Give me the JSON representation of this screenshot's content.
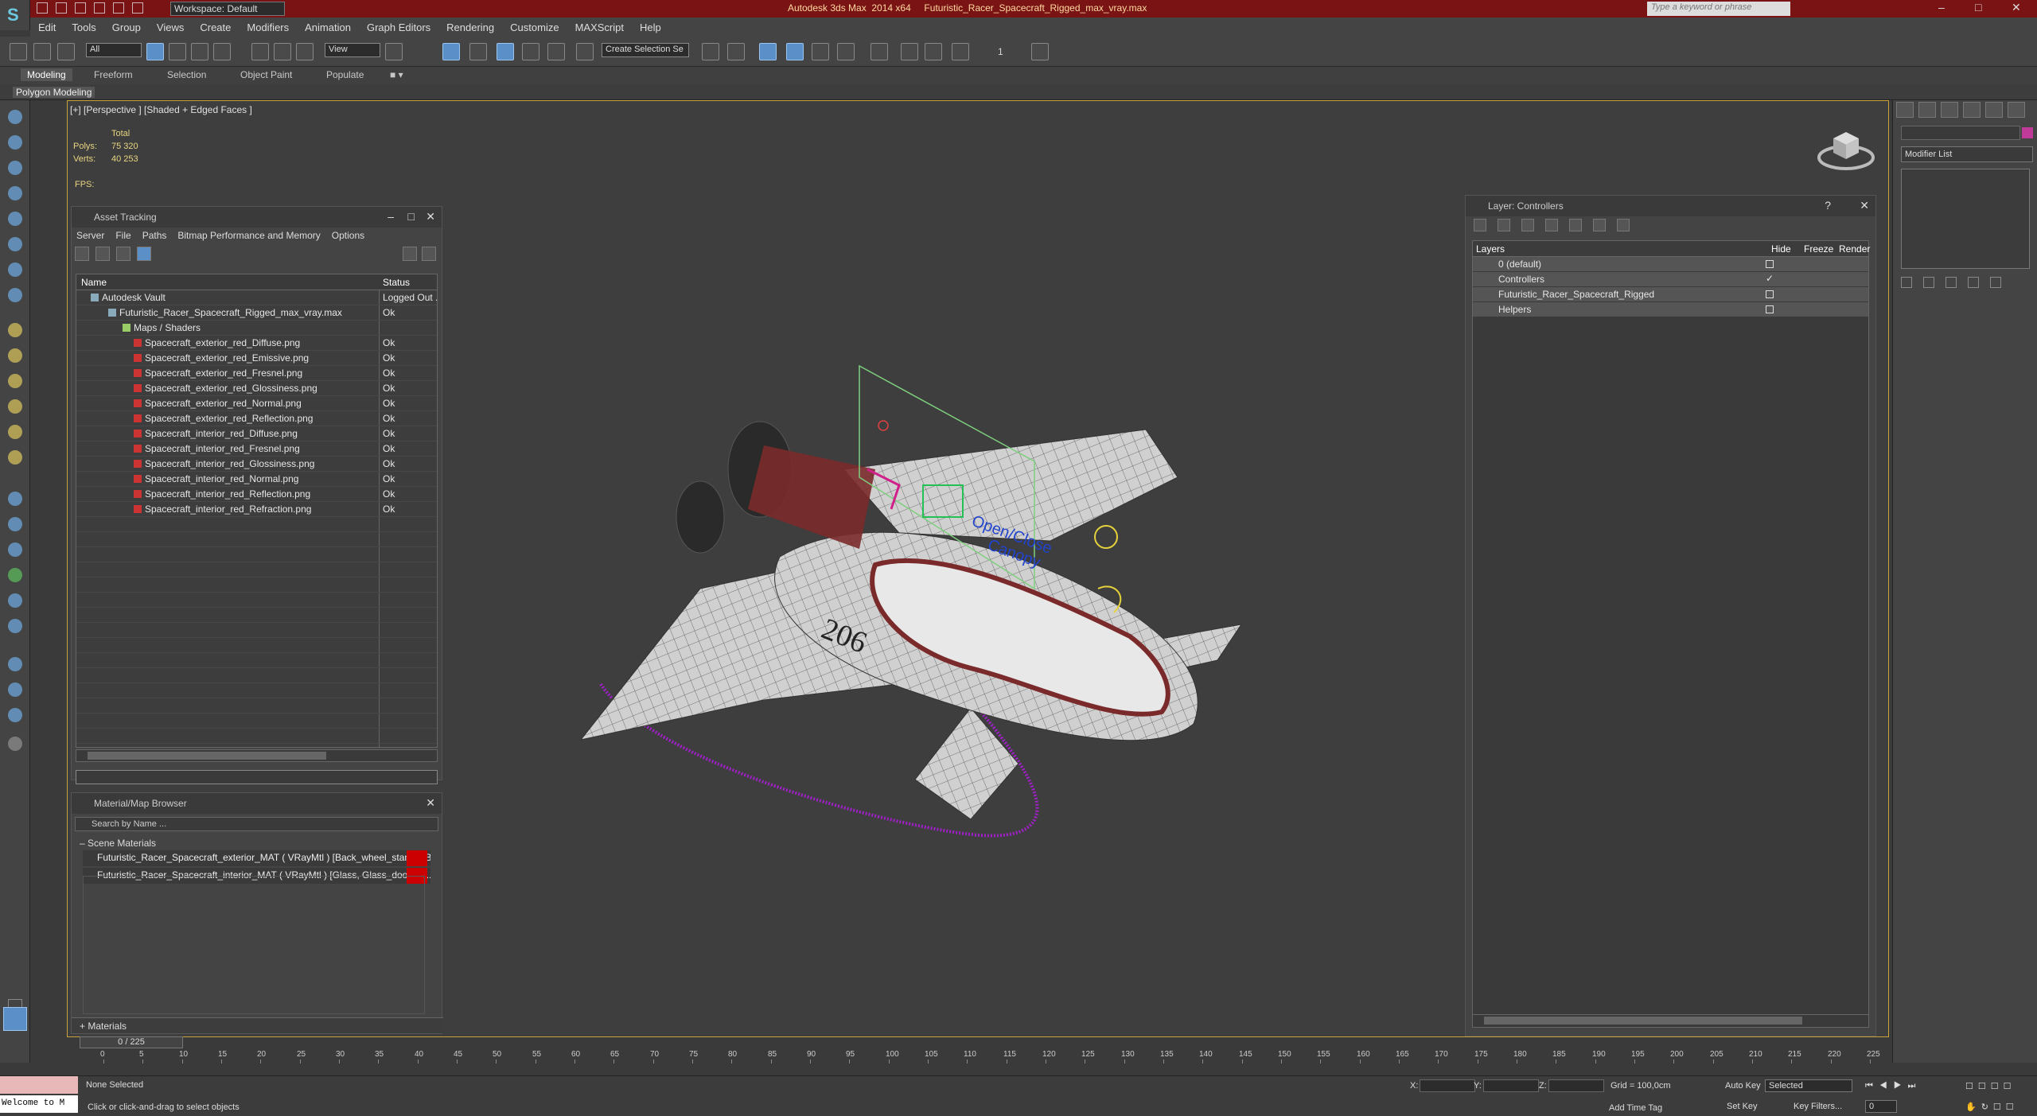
{
  "titlebar": {
    "title": "Autodesk 3ds Max  2014 x64     Futuristic_Racer_Spacecraft_Rigged_max_vray.max",
    "workspace": "Workspace: Default",
    "search_placeholder": "Type a keyword or phrase"
  },
  "menu": [
    "Edit",
    "Tools",
    "Group",
    "Views",
    "Create",
    "Modifiers",
    "Animation",
    "Graph Editors",
    "Rendering",
    "Customize",
    "MAXScript",
    "Help"
  ],
  "toolbar": {
    "filter_all": "All",
    "ref_coord": "View",
    "selection_set": "Create Selection Se",
    "spinner_value": "1"
  },
  "ribbon": {
    "tabs": [
      "Modeling",
      "Freeform",
      "Selection",
      "Object Paint",
      "Populate"
    ],
    "sub_tab": "Polygon Modeling"
  },
  "viewport": {
    "label": "[+] [Perspective ] [Shaded + Edged Faces ]",
    "stats_total": "Total",
    "polys_label": "Polys:",
    "polys_value": "75 320",
    "verts_label": "Verts:",
    "verts_value": "40 253",
    "fps_label": "FPS:",
    "hull_number": "206",
    "rig_text_1": "Open/Close",
    "rig_text_2": "Canopy"
  },
  "asset_tracking": {
    "title": "Asset Tracking",
    "menu": [
      "Server",
      "File",
      "Paths",
      "Bitmap Performance and Memory",
      "Options"
    ],
    "col_name": "Name",
    "col_status": "Status",
    "rows": [
      {
        "name": "Autodesk Vault",
        "status": "Logged Out ..."
      },
      {
        "name": "Futuristic_Racer_Spacecraft_Rigged_max_vray.max",
        "status": "Ok"
      },
      {
        "name": "Maps / Shaders",
        "status": ""
      },
      {
        "name": "Spacecraft_exterior_red_Diffuse.png",
        "status": "Ok"
      },
      {
        "name": "Spacecraft_exterior_red_Emissive.png",
        "status": "Ok"
      },
      {
        "name": "Spacecraft_exterior_red_Fresnel.png",
        "status": "Ok"
      },
      {
        "name": "Spacecraft_exterior_red_Glossiness.png",
        "status": "Ok"
      },
      {
        "name": "Spacecraft_exterior_red_Normal.png",
        "status": "Ok"
      },
      {
        "name": "Spacecraft_exterior_red_Reflection.png",
        "status": "Ok"
      },
      {
        "name": "Spacecraft_interior_red_Diffuse.png",
        "status": "Ok"
      },
      {
        "name": "Spacecraft_interior_red_Fresnel.png",
        "status": "Ok"
      },
      {
        "name": "Spacecraft_interior_red_Glossiness.png",
        "status": "Ok"
      },
      {
        "name": "Spacecraft_interior_red_Normal.png",
        "status": "Ok"
      },
      {
        "name": "Spacecraft_interior_red_Reflection.png",
        "status": "Ok"
      },
      {
        "name": "Spacecraft_interior_red_Refraction.png",
        "status": "Ok"
      }
    ]
  },
  "material_browser": {
    "title": "Material/Map Browser",
    "search_placeholder": "Search by Name ...",
    "section": "Scene Materials",
    "materials": [
      "Futuristic_Racer_Spacecraft_exterior_MAT ( VRayMtl ) [Back_wheel_stands, B...",
      "Futuristic_Racer_Spacecraft_interior_MAT ( VRayMtl ) [Glass, Glass_door, Int..."
    ],
    "footer": "+ Materials"
  },
  "layers": {
    "title": "Layer: Controllers",
    "col_layers": "Layers",
    "col_hide": "Hide",
    "col_freeze": "Freeze",
    "col_render": "Render",
    "rows": [
      "0 (default)",
      "Controllers",
      "Futuristic_Racer_Spacecraft_Rigged",
      "Helpers"
    ]
  },
  "command_panel": {
    "modifier_list": "Modifier List"
  },
  "timeline": {
    "frames": "0 / 225",
    "ticks": [
      "0",
      "5",
      "10",
      "15",
      "20",
      "25",
      "30",
      "35",
      "40",
      "45",
      "50",
      "55",
      "60",
      "65",
      "70",
      "75",
      "80",
      "85",
      "90",
      "95",
      "100",
      "105",
      "110",
      "115",
      "120",
      "125",
      "130",
      "135",
      "140",
      "145",
      "150",
      "155",
      "160",
      "165",
      "170",
      "175",
      "180",
      "185",
      "190",
      "195",
      "200",
      "205",
      "210",
      "215",
      "220",
      "225"
    ]
  },
  "status": {
    "selection": "None Selected",
    "prompt": "Click or click-and-drag to select objects",
    "listener": "Welcome to M",
    "x_label": "X:",
    "y_label": "Y:",
    "z_label": "Z:",
    "grid": "Grid = 100,0cm",
    "add_time_tag": "Add Time Tag",
    "auto_key": "Auto Key",
    "set_key": "Set Key",
    "selected": "Selected",
    "key_filters": "Key Filters...",
    "frame_value": "0"
  },
  "colors": {
    "title_bar": "#7a1414",
    "viewport_border": "#c9a43a",
    "stats_text": "#e8d580",
    "hull_accent": "#7a2a2a",
    "spline": "#a020c8"
  }
}
